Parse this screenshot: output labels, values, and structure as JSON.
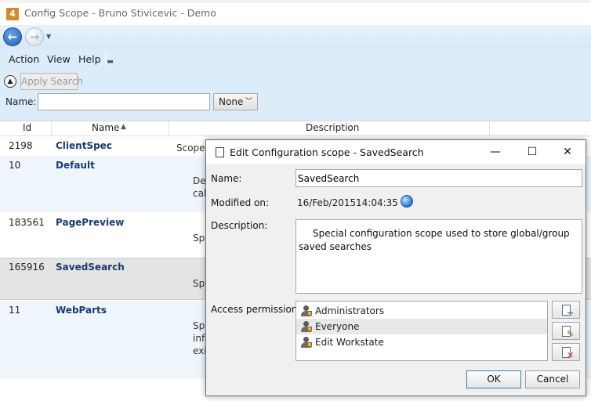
{
  "window": {
    "title": "Config Scope - Bruno Stivicevic - Demo",
    "app_icon_glyph": "4"
  },
  "nav": {
    "back_icon": "back-arrow-icon",
    "forward_icon": "forward-arrow-icon"
  },
  "menu": {
    "items": [
      "Action",
      "View",
      "Help"
    ]
  },
  "toolbar": {
    "apply_search_label": "Apply Search",
    "name_label": "Name:",
    "name_value": "",
    "filter_selected": "None"
  },
  "grid": {
    "columns": [
      "Id",
      "Name",
      "Description"
    ],
    "sort_column": "Name",
    "rows": [
      {
        "id": "2198",
        "name": "ClientSpec",
        "desc": "Scope"
      },
      {
        "id": "10",
        "name": "Default",
        "desc": "Def\ncall"
      },
      {
        "id": "183561",
        "name": "PagePreview",
        "desc": "Spe"
      },
      {
        "id": "165916",
        "name": "SavedSearch",
        "desc": "Spe"
      },
      {
        "id": "11",
        "name": "WebParts",
        "desc": "Spe\ninfo\nexis"
      }
    ],
    "selected_row": 3
  },
  "dialog": {
    "title": "Edit Configuration scope - SavedSearch",
    "name_label": "Name:",
    "name_value": "SavedSearch",
    "modified_label": "Modified on:",
    "modified_date": "16/Feb/2015",
    "modified_time": "14:04:35",
    "description_label": "Description:",
    "description_value": "Special configuration scope used to store global/group saved searches",
    "permissions_label": "Access permissions:",
    "permissions": [
      "Administrators",
      "Everyone",
      "Edit Workstate"
    ],
    "selected_permission": 1,
    "ok_label": "OK",
    "cancel_label": "Cancel",
    "minimize_glyph": "—",
    "maximize_glyph": "☐",
    "close_glyph": "✕"
  },
  "colors": {
    "ribbon": "#dcecf8",
    "link_blue": "#1a3a6e",
    "selected_row": "#e4e4e4",
    "accent": "#3c7fb1"
  }
}
